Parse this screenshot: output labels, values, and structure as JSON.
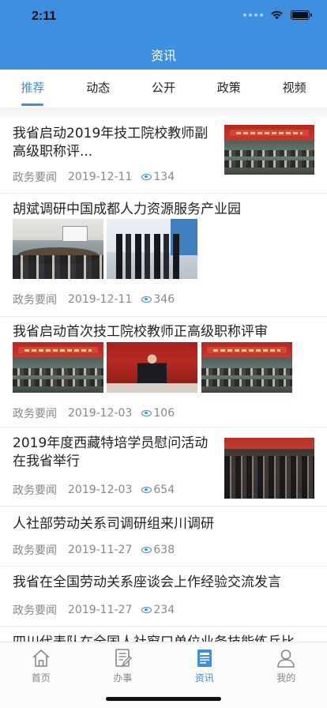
{
  "status": {
    "time": "2:11"
  },
  "header": {
    "title": "资讯"
  },
  "colors": {
    "accent": "#3d8fe0"
  },
  "tabs": [
    {
      "label": "推荐",
      "active": true
    },
    {
      "label": "动态",
      "active": false
    },
    {
      "label": "公开",
      "active": false
    },
    {
      "label": "政策",
      "active": false
    },
    {
      "label": "视频",
      "active": false
    }
  ],
  "articles": [
    {
      "title": "我省启动2019年技工院校教师副高级职称评...",
      "source": "政务要闻",
      "date": "2019-12-11",
      "views": "134"
    },
    {
      "title": "胡斌调研中国成都人力资源服务产业园",
      "source": "政务要闻",
      "date": "2019-12-11",
      "views": "346"
    },
    {
      "title": "我省启动首次技工院校教师正高级职称评审",
      "source": "政务要闻",
      "date": "2019-12-03",
      "views": "106"
    },
    {
      "title": "2019年度西藏特培学员慰问活动在我省举行",
      "source": "政务要闻",
      "date": "2019-12-03",
      "views": "654"
    },
    {
      "title": "人社部劳动关系司调研组来川调研",
      "source": "政务要闻",
      "date": "2019-11-27",
      "views": "638"
    },
    {
      "title": "我省在全国劳动关系座谈会上作经验交流发言",
      "source": "政务要闻",
      "date": "2019-11-27",
      "views": "234"
    },
    {
      "title": "四川代表队在全国人社窗口单位业务技能练兵比",
      "source": "",
      "date": "",
      "views": ""
    }
  ],
  "bottom_nav": [
    {
      "label": "首页",
      "icon": "home-icon",
      "active": false
    },
    {
      "label": "办事",
      "icon": "document-edit-icon",
      "active": false
    },
    {
      "label": "资讯",
      "icon": "news-icon",
      "active": true
    },
    {
      "label": "我的",
      "icon": "user-icon",
      "active": false
    }
  ]
}
